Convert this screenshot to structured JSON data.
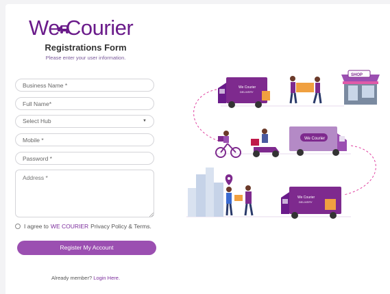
{
  "logo": {
    "we": "We",
    "courier": "Courier"
  },
  "form": {
    "title": "Registrations Form",
    "subtitle": "Please enter your user information.",
    "business_name_placeholder": "Business Name *",
    "full_name_placeholder": "Full Name*",
    "hub_selected": "Select Hub",
    "mobile_placeholder": "Mobile *",
    "password_placeholder": "Password *",
    "address_placeholder": "Address *",
    "agree_prefix": "I agree to",
    "agree_brand": "WE COURIER",
    "agree_suffix": "Privacy Policy & Terms.",
    "register_label": "Register My Account",
    "already_member": "Already member?",
    "login_link": "Login Here."
  },
  "illustration": {
    "truck_label_top": "We Courier",
    "truck_label_bottom": "DELIVERY",
    "van_label": "We Courier",
    "shop_label": "SHOP"
  },
  "colors": {
    "brand_purple": "#6a1b8a",
    "button": "#9b4fb1",
    "truck": "#7e2a8e",
    "accent": "#e040a0"
  }
}
